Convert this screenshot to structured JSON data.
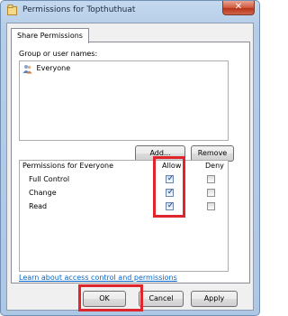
{
  "window": {
    "title": "Permissions for Topthuthuat",
    "close_glyph": "✕"
  },
  "tabs": [
    {
      "label": "Share Permissions"
    }
  ],
  "group_section": {
    "label": "Group or user names:",
    "users": [
      {
        "name": "Everyone",
        "icon": "users-group-icon",
        "selected": true
      }
    ],
    "add_label": "Add...",
    "remove_label": "Remove"
  },
  "permissions": {
    "header": "Permissions for Everyone",
    "allow_label": "Allow",
    "deny_label": "Deny",
    "rows": [
      {
        "name": "Full Control",
        "allow": true,
        "deny": false
      },
      {
        "name": "Change",
        "allow": true,
        "deny": false
      },
      {
        "name": "Read",
        "allow": true,
        "deny": false
      }
    ]
  },
  "link_text": "Learn about access control and permissions",
  "footer": {
    "ok_label": "OK",
    "cancel_label": "Cancel",
    "apply_label": "Apply"
  },
  "colors": {
    "highlight": "#e0262d",
    "link": "#0066cc",
    "close_button": "#c8452b"
  }
}
